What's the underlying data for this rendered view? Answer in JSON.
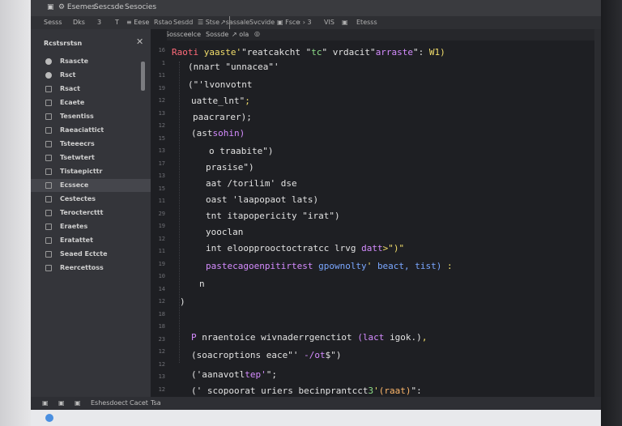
{
  "menubar": {
    "items": [
      "▣",
      "⚙ Esemes",
      "Sescsde",
      "Sesocies"
    ]
  },
  "tabs": [
    "Rstao",
    "Sesdd",
    "☰ Stse",
    "↗sassale",
    "Svcvide",
    "▣ Fsce",
    "‹ › 3",
    "VIS",
    "▣",
    "Etesss"
  ],
  "editor_toolbar": {
    "items": [
      "Sossceelce",
      "Sossde",
      "↗ ola",
      "◎"
    ]
  },
  "sidebar": {
    "title": "Rcstsrstsn",
    "close": "✕",
    "toolbar": [
      "Sesss",
      "Dks",
      "3",
      "T",
      "≡ Eese"
    ],
    "items": [
      {
        "label": "Rsascte",
        "icon": "round",
        "selected": false
      },
      {
        "label": "Rsct",
        "icon": "round",
        "selected": false
      },
      {
        "label": "Rsact",
        "icon": "square",
        "selected": false
      },
      {
        "label": "Ecaete",
        "icon": "square",
        "selected": false
      },
      {
        "label": "Tesentiss",
        "icon": "square",
        "selected": false
      },
      {
        "label": "Raeaciattict",
        "icon": "square",
        "selected": false
      },
      {
        "label": "Tsteeecrs",
        "icon": "square",
        "selected": false
      },
      {
        "label": "Tsetwtert",
        "icon": "square",
        "selected": false
      },
      {
        "label": "Tistaepicttr",
        "icon": "square",
        "selected": false
      },
      {
        "label": "Ecssece",
        "icon": "square",
        "selected": true
      },
      {
        "label": "Cestectes",
        "icon": "square",
        "selected": false
      },
      {
        "label": "Teroctercttt",
        "icon": "square",
        "selected": false
      },
      {
        "label": "Eraetes",
        "icon": "square",
        "selected": false
      },
      {
        "label": "Eratattet",
        "icon": "square",
        "selected": false
      },
      {
        "label": "Seaed Ectcte",
        "icon": "square",
        "selected": false
      },
      {
        "label": "Reercettoss",
        "icon": "square",
        "selected": false
      }
    ]
  },
  "line_numbers": [
    "16",
    "1",
    "11",
    "19",
    "12",
    "13",
    "12",
    "15",
    "13",
    "17",
    "13",
    "15",
    "11",
    "29",
    "19",
    "12",
    "11",
    "19",
    "10",
    "14",
    "12",
    "18",
    "18",
    "23",
    "12",
    "12",
    "13",
    "12"
  ],
  "code": [
    [
      {
        "t": "Raoti ",
        "c": "red"
      },
      {
        "t": "yaaste'",
        "c": "yellow"
      },
      {
        "t": "\"reatcakcht \"",
        "c": "white"
      },
      {
        "t": "tc",
        "c": "green"
      },
      {
        "t": "\" vrdacit\"",
        "c": "white"
      },
      {
        "t": "arraste",
        "c": "purple"
      },
      {
        "t": "\": ",
        "c": "white"
      },
      {
        "t": "W1)",
        "c": "yellow"
      }
    ],
    [
      {
        "t": "(nnart \"unnacea\"'",
        "c": "white"
      }
    ],
    [
      {
        "t": "(\"'lvonvotnt",
        "c": "white"
      }
    ],
    [
      {
        "t": "uatte_lnt\"",
        "c": "white"
      },
      {
        "t": ";",
        "c": "yellow"
      }
    ],
    [
      {
        "t": "paacrarer);",
        "c": "white"
      }
    ],
    [
      {
        "t": "(ast",
        "c": "white"
      },
      {
        "t": "sohin)",
        "c": "purple"
      }
    ],
    [
      {
        "t": "o ",
        "c": "white"
      },
      {
        "t": "traabite\")",
        "c": "white"
      }
    ],
    [
      {
        "t": "prasise\")",
        "c": "white"
      }
    ],
    [
      {
        "t": "aat /torilim' dse",
        "c": "white"
      }
    ],
    [
      {
        "t": "oast ",
        "c": "white"
      },
      {
        "t": "'laapopaot lats)",
        "c": "white"
      }
    ],
    [
      {
        "t": "tnt ",
        "c": "white"
      },
      {
        "t": "itapopericity \"irat\")",
        "c": "white"
      }
    ],
    [
      {
        "t": "yooclan",
        "c": "white"
      }
    ],
    [
      {
        "t": "int ",
        "c": "white"
      },
      {
        "t": "eloopprooctoctratcc lrvg ",
        "c": "white"
      },
      {
        "t": "datt",
        "c": "purple"
      },
      {
        "t": ">\")\"",
        "c": "yellow"
      }
    ],
    [
      {
        "t": "pastecagoenpitirtest ",
        "c": "purple"
      },
      {
        "t": "gpownolty",
        "c": "blue"
      },
      {
        "t": "' ",
        "c": "yellow"
      },
      {
        "t": "beact, tist) ",
        "c": "blue"
      },
      {
        "t": ":",
        "c": "yellow"
      }
    ],
    [
      {
        "t": "n",
        "c": "white"
      }
    ],
    [
      {
        "t": ")",
        "c": "white"
      }
    ],
    [
      {
        "t": "P ",
        "c": "purple"
      },
      {
        "t": "nraentoice wivnaderrgenctiot ",
        "c": "white"
      },
      {
        "t": "(lact ",
        "c": "purple"
      },
      {
        "t": "igok.)",
        "c": "white"
      },
      {
        "t": ",",
        "c": "yellow"
      }
    ],
    [
      {
        "t": "(soacroptions eace\"' ",
        "c": "white"
      },
      {
        "t": "-/ot",
        "c": "purple"
      },
      {
        "t": "$\")",
        "c": "white"
      }
    ],
    [
      {
        "t": "('aanavotl",
        "c": "white"
      },
      {
        "t": "tep'",
        "c": "purple"
      },
      {
        "t": "\";",
        "c": "white"
      }
    ],
    [
      {
        "t": "(' scopoorat uriers becinprantcct",
        "c": "white"
      },
      {
        "t": "3",
        "c": "green"
      },
      {
        "t": "'",
        "c": "yellow"
      },
      {
        "t": "(raat)",
        "c": "orange"
      },
      {
        "t": "\":",
        "c": "white"
      }
    ]
  ],
  "statusbar": {
    "items": [
      "▣",
      "▣",
      "▣",
      "Eshesdoect",
      "Cacet",
      "Tsa"
    ]
  }
}
